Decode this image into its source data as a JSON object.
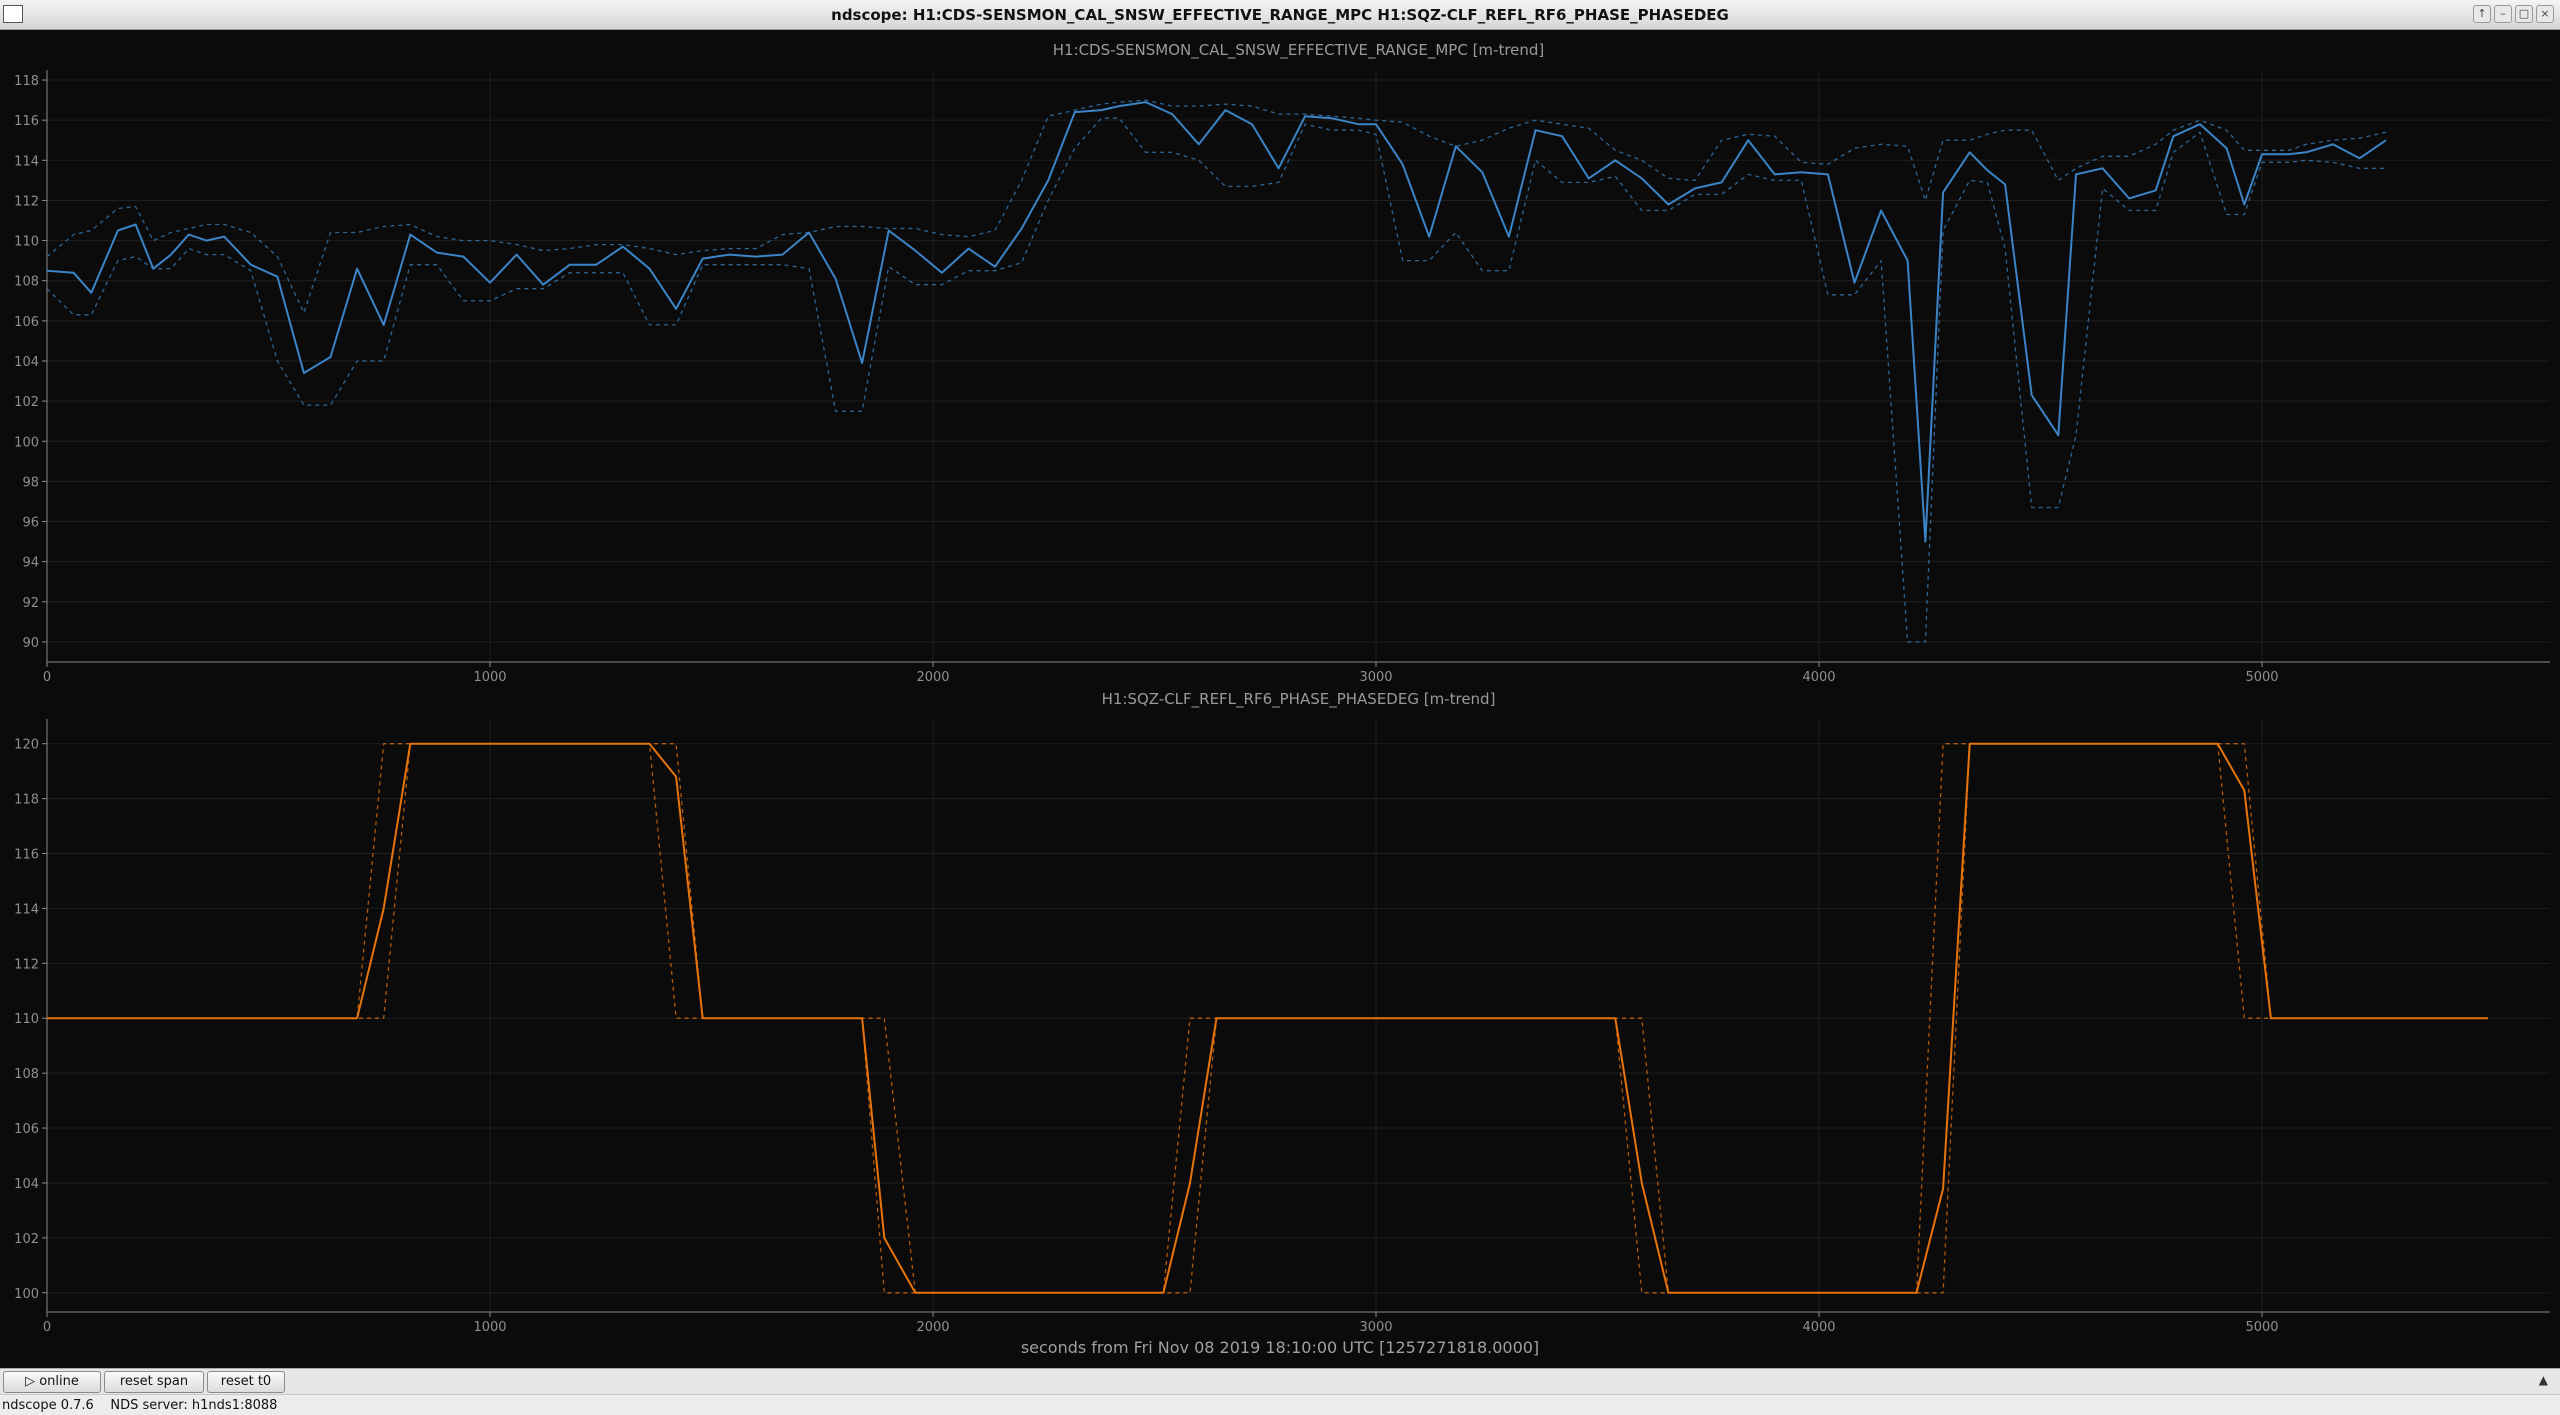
{
  "window": {
    "title": "ndscope: H1:CDS-SENSMON_CAL_SNSW_EFFECTIVE_RANGE_MPC H1:SQZ-CLF_REFL_RF6_PHASE_PHASEDEG",
    "controls": [
      "↑",
      "–",
      "□",
      "×"
    ]
  },
  "toolbar": {
    "online_label": "▷ online",
    "reset_span_label": "reset span",
    "reset_t0_label": "reset t0",
    "expand_glyph": "▲"
  },
  "status": {
    "version": "ndscope 0.7.6",
    "server": "NDS server: h1nds1:8088"
  },
  "colors": {
    "background": "#0b0b0b",
    "axis": "#8a8a8a",
    "grid": "#1f1f1f",
    "series_top": "#3b84c6",
    "series_bottom": "#e8740c"
  },
  "chart_data": [
    {
      "type": "line",
      "title": "H1:CDS-SENSMON_CAL_SNSW_EFFECTIVE_RANGE_MPC [m-trend]",
      "xlim": [
        0,
        5650
      ],
      "ylim": [
        89,
        118.5
      ],
      "xticks": [
        0,
        1000,
        2000,
        3000,
        4000,
        5000
      ],
      "yticks": [
        90,
        92,
        94,
        96,
        98,
        100,
        102,
        104,
        106,
        108,
        110,
        112,
        114,
        116,
        118
      ],
      "x": [
        0,
        60,
        100,
        160,
        200,
        240,
        280,
        320,
        360,
        400,
        460,
        520,
        580,
        640,
        700,
        760,
        820,
        880,
        940,
        1000,
        1060,
        1120,
        1180,
        1240,
        1300,
        1360,
        1420,
        1480,
        1540,
        1600,
        1660,
        1720,
        1780,
        1840,
        1900,
        1960,
        2020,
        2080,
        2140,
        2200,
        2260,
        2320,
        2380,
        2420,
        2480,
        2540,
        2600,
        2660,
        2720,
        2780,
        2840,
        2900,
        2960,
        3000,
        3060,
        3120,
        3180,
        3240,
        3300,
        3360,
        3420,
        3480,
        3540,
        3600,
        3660,
        3720,
        3780,
        3840,
        3900,
        3960,
        4020,
        4080,
        4140,
        4200,
        4240,
        4280,
        4340,
        4380,
        4420,
        4480,
        4540,
        4580,
        4640,
        4700,
        4760,
        4800,
        4860,
        4920,
        4960,
        5000,
        5060,
        5100,
        5160,
        5220,
        5280,
        5340,
        5400,
        5460,
        5520
      ],
      "series": [
        {
          "role": "mean",
          "values": [
            108.5,
            108.4,
            107.4,
            110.5,
            110.8,
            108.6,
            109.3,
            110.3,
            110.0,
            110.2,
            108.8,
            108.2,
            103.4,
            104.2,
            108.6,
            105.8,
            110.3,
            109.4,
            109.2,
            107.9,
            109.3,
            107.8,
            108.8,
            108.8,
            109.7,
            108.6,
            106.6,
            109.1,
            109.3,
            109.2,
            109.3,
            110.4,
            108.1,
            103.9,
            110.5,
            109.5,
            108.4,
            109.6,
            108.7,
            110.6,
            113.0,
            116.4,
            116.5,
            116.7,
            116.9,
            116.3,
            114.8,
            116.5,
            115.8,
            113.6,
            116.2,
            116.1,
            115.8,
            115.8,
            113.8,
            110.2,
            114.7,
            113.4,
            110.2,
            115.5,
            115.2,
            113.1,
            114.0,
            113.1,
            111.8,
            112.6,
            112.9,
            115.0,
            113.3,
            113.4,
            113.3,
            107.9,
            111.5,
            109.0,
            95.0,
            112.4,
            114.4,
            113.5,
            112.8,
            102.3,
            100.3,
            113.3,
            113.6,
            112.1,
            112.5,
            115.2,
            115.8,
            114.6,
            111.8,
            114.3,
            114.3,
            114.4,
            114.8,
            114.1,
            115.0,
            null,
            null,
            null,
            null
          ]
        },
        {
          "role": "max",
          "values": [
            109.2,
            110.3,
            110.5,
            111.6,
            111.7,
            110.0,
            110.4,
            110.6,
            110.8,
            110.8,
            110.4,
            109.2,
            106.4,
            110.4,
            110.4,
            110.7,
            110.8,
            110.2,
            110.0,
            110.0,
            109.8,
            109.5,
            109.6,
            109.8,
            109.8,
            109.6,
            109.3,
            109.5,
            109.6,
            109.6,
            110.3,
            110.4,
            110.7,
            110.7,
            110.6,
            110.6,
            110.3,
            110.2,
            110.5,
            113.0,
            116.2,
            116.5,
            116.8,
            116.9,
            117.0,
            116.7,
            116.7,
            116.8,
            116.7,
            116.3,
            116.3,
            116.2,
            116.1,
            116.0,
            115.9,
            115.2,
            114.7,
            115.0,
            115.6,
            116.0,
            115.8,
            115.6,
            114.5,
            114.0,
            113.1,
            113.0,
            115.0,
            115.3,
            115.2,
            113.9,
            113.8,
            114.6,
            114.8,
            114.7,
            112.0,
            115.0,
            115.0,
            115.3,
            115.5,
            115.5,
            113.0,
            113.6,
            114.2,
            114.2,
            114.8,
            115.5,
            116.0,
            115.5,
            114.5,
            114.5,
            114.5,
            114.8,
            115.0,
            115.1,
            115.4,
            null,
            null,
            null,
            null
          ]
        },
        {
          "role": "min",
          "values": [
            107.6,
            106.3,
            106.3,
            109.0,
            109.2,
            108.6,
            108.6,
            109.6,
            109.3,
            109.3,
            108.5,
            104.0,
            101.8,
            101.8,
            104.0,
            104.0,
            108.8,
            108.8,
            107.0,
            107.0,
            107.6,
            107.6,
            108.4,
            108.4,
            108.4,
            105.8,
            105.8,
            108.8,
            108.8,
            108.8,
            108.8,
            108.6,
            101.5,
            101.5,
            108.7,
            107.8,
            107.8,
            108.5,
            108.5,
            108.9,
            112.0,
            114.6,
            116.1,
            116.1,
            114.4,
            114.4,
            114.0,
            112.7,
            112.7,
            112.9,
            115.8,
            115.5,
            115.5,
            115.3,
            109.0,
            109.0,
            110.4,
            108.5,
            108.5,
            114.0,
            112.9,
            112.9,
            113.2,
            111.5,
            111.5,
            112.3,
            112.3,
            113.3,
            113.0,
            113.0,
            107.3,
            107.3,
            109.0,
            90.0,
            90.0,
            110.5,
            113.0,
            112.9,
            109.6,
            96.7,
            96.7,
            100.3,
            112.6,
            111.5,
            111.5,
            114.4,
            115.4,
            111.3,
            111.3,
            113.9,
            113.9,
            114.0,
            113.9,
            113.6,
            113.6,
            null,
            null,
            null,
            null
          ]
        }
      ]
    },
    {
      "type": "line",
      "title": "H1:SQZ-CLF_REFL_RF6_PHASE_PHASEDEG [m-trend]",
      "xlim": [
        0,
        5650
      ],
      "ylim": [
        99.3,
        120.9
      ],
      "xticks": [
        0,
        1000,
        2000,
        3000,
        4000,
        5000
      ],
      "yticks": [
        100,
        102,
        104,
        106,
        108,
        110,
        112,
        114,
        116,
        118,
        120
      ],
      "x": [
        0,
        700,
        760,
        820,
        1360,
        1420,
        1480,
        1840,
        1890,
        1960,
        2520,
        2580,
        2640,
        3540,
        3600,
        3660,
        4220,
        4280,
        4340,
        4900,
        4960,
        5020,
        5510
      ],
      "series": [
        {
          "role": "mean",
          "values": [
            110,
            110,
            114,
            120,
            120,
            118.8,
            110,
            110,
            102,
            100,
            100,
            104,
            110,
            110,
            104,
            100,
            100,
            103.8,
            120,
            120,
            118.3,
            110,
            110
          ]
        },
        {
          "role": "max",
          "values": [
            110,
            110,
            120,
            120,
            120,
            120,
            110,
            110,
            110,
            100,
            100,
            110,
            110,
            110,
            110,
            100,
            100,
            120,
            120,
            120,
            120,
            110,
            110
          ]
        },
        {
          "role": "min",
          "values": [
            110,
            110,
            110,
            120,
            120,
            110,
            110,
            110,
            100,
            100,
            100,
            100,
            110,
            110,
            100,
            100,
            100,
            100,
            120,
            120,
            110,
            110,
            110
          ]
        }
      ]
    }
  ],
  "xlabel": "seconds from Fri Nov 08 2019 18:10:00 UTC [1257271818.0000]"
}
